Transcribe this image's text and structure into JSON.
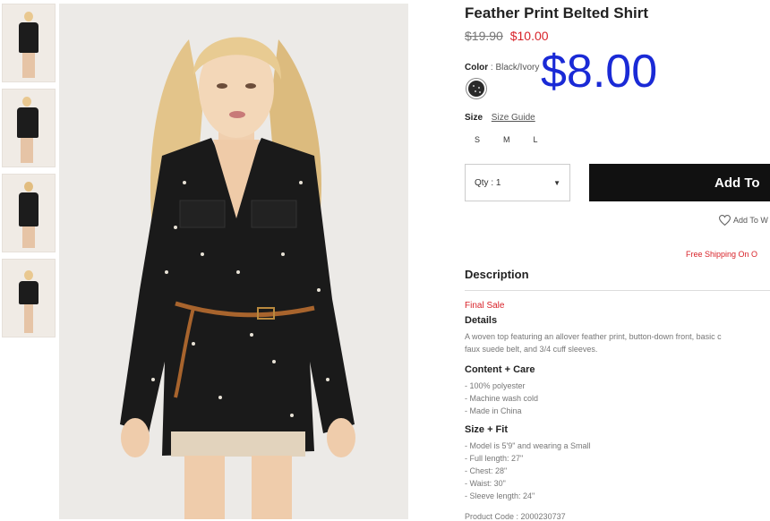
{
  "product": {
    "title": "Feather Print Belted Shirt",
    "price_original": "$19.90",
    "price_sale": "$10.00",
    "overlay_price": "$8.00"
  },
  "color": {
    "label": "Color",
    "value": "Black/Ivory",
    "swatch_hex": "#2a2a2a"
  },
  "size": {
    "label": "Size",
    "guide": "Size Guide",
    "options": [
      "S",
      "M",
      "L"
    ]
  },
  "quantity": {
    "label": "Qty : 1"
  },
  "add_to_bag": "Add To",
  "wishlist": "Add To W",
  "shipping": "Free Shipping On O",
  "description": {
    "heading": "Description",
    "final_sale": "Final Sale",
    "details_heading": "Details",
    "details_line1": "A woven top featuring an allover feather print, button-down front, basic c",
    "details_line2": "faux suede belt, and 3/4 cuff sleeves.",
    "content_heading": "Content + Care",
    "content": [
      "- 100% polyester",
      "- Machine wash cold",
      "- Made in China"
    ],
    "fit_heading": "Size + Fit",
    "fit": [
      "- Model is 5'9\" and wearing a Small",
      "- Full length: 27\"",
      "- Chest: 28\"",
      "- Waist: 30\"",
      "- Sleeve length: 24\""
    ],
    "product_code": "Product Code : 2000230737"
  },
  "colors": {
    "sale_red": "#d8232a",
    "overlay_blue": "#1a2ad6",
    "button_black": "#111111"
  }
}
